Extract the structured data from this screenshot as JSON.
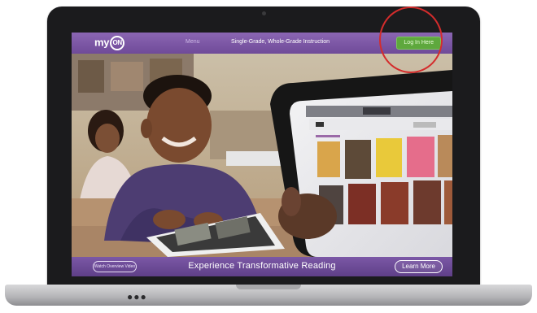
{
  "header": {
    "logo_text": "my",
    "logo_on": "ON",
    "dim_link": "Menu",
    "tagline": "Single-Grade, Whole-Grade Instruction",
    "login_label": "Log In Here"
  },
  "footer": {
    "small_button_label": "Watch Overview Video",
    "headline": "Experience Transformative Reading",
    "learn_more_label": "Learn More"
  },
  "colors": {
    "brand_purple": "#7250a0",
    "login_green": "#5ea83d",
    "annotation_red": "#d42c2c"
  },
  "icons": [
    "camera-icon",
    "keyboard-dots-icon"
  ]
}
